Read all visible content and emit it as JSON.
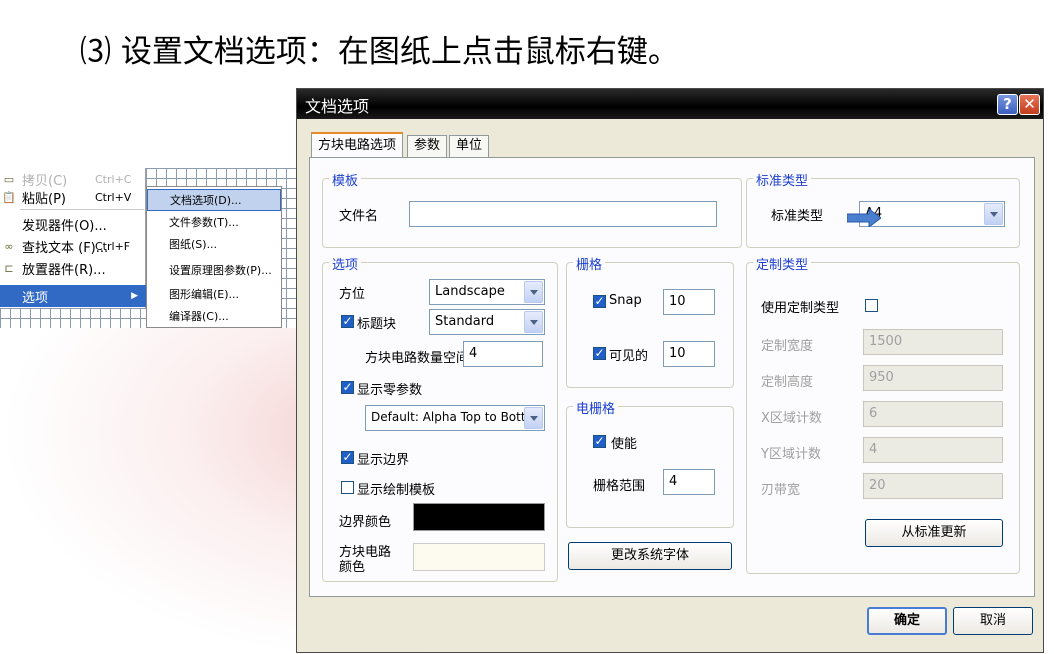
{
  "slide": {
    "title": "⑶ 设置文档选项：在图纸上点击鼠标右键。"
  },
  "context_menu": {
    "items": [
      {
        "icon": "copy-icon",
        "label": "拷贝(C)",
        "shortcut": "Ctrl+C",
        "faded": true
      },
      {
        "icon": "paste-icon",
        "label": "粘贴(P)",
        "shortcut": "Ctrl+V"
      },
      {
        "icon": "",
        "label": "发现器件(O)...",
        "shortcut": ""
      },
      {
        "icon": "binoculars-icon",
        "label": "查找文本 (F)...",
        "shortcut": "Ctrl+F"
      },
      {
        "icon": "place-part-icon",
        "label": "放置器件(R)...",
        "shortcut": ""
      },
      {
        "icon": "",
        "label": "选项",
        "shortcut": "",
        "selected": true,
        "arrow": "▶"
      }
    ]
  },
  "sub_menu": {
    "items": [
      {
        "label": "文档选项(D)...",
        "selected": true
      },
      {
        "label": "文件参数(T)..."
      },
      {
        "label": "图纸(S)..."
      },
      {
        "label": "设置原理图参数(P)..."
      },
      {
        "label": "图形编辑(E)..."
      },
      {
        "label": "编译器(C)..."
      }
    ]
  },
  "dialog": {
    "title": "文档选项",
    "help_glyph": "?",
    "close_glyph": "✕",
    "tabs": [
      "方块电路选项",
      "参数",
      "单位"
    ],
    "template_group": {
      "title": "模板",
      "file_label": "文件名",
      "file_value": ""
    },
    "standard_group": {
      "title": "标准类型",
      "label": "标准类型",
      "value": "A4"
    },
    "options_group": {
      "title": "选项",
      "orientation_label": "方位",
      "orientation_value": "Landscape",
      "title_block_label": "标题块",
      "title_block_checked": true,
      "title_block_value": "Standard",
      "sheet_number_spaces_label": "方块电路数量空间",
      "sheet_number_spaces_value": "4",
      "show_reference_zones_label": "显示零参数",
      "show_reference_zones_checked": true,
      "reference_zones_value": "Default: Alpha Top to Bottom,",
      "show_border_label": "显示边界",
      "show_border_checked": true,
      "show_template_graphics_label": "显示绘制模板",
      "show_template_graphics_checked": false,
      "border_color_label": "边界颜色",
      "border_color": "#000000",
      "sheet_color_label": "方块电路\n颜色",
      "sheet_color": "#fdfaf0"
    },
    "grid_group": {
      "title": "栅格",
      "snap_label": "Snap",
      "snap_checked": true,
      "snap_value": "10",
      "visible_label": "可见的",
      "visible_checked": true,
      "visible_value": "10"
    },
    "electrical_grid_group": {
      "title": "电栅格",
      "enable_label": "使能",
      "enable_checked": true,
      "range_label": "栅格范围",
      "range_value": "4"
    },
    "change_font_button": "更改系统字体",
    "custom_group": {
      "title": "定制类型",
      "use_custom_label": "使用定制类型",
      "use_custom_checked": false,
      "width_label": "定制宽度",
      "width_value": "1500",
      "height_label": "定制高度",
      "height_value": "950",
      "x_zones_label": "X区域计数",
      "x_zones_value": "6",
      "y_zones_label": "Y区域计数",
      "y_zones_value": "4",
      "margin_label": "刃带宽",
      "margin_value": "20",
      "update_button": "从标准更新"
    },
    "ok_button": "确定",
    "cancel_button": "取消"
  },
  "colors": {
    "title_bar": "#000000",
    "dialog_bg": "#ece9d8",
    "accent": "#1c3fd0"
  }
}
